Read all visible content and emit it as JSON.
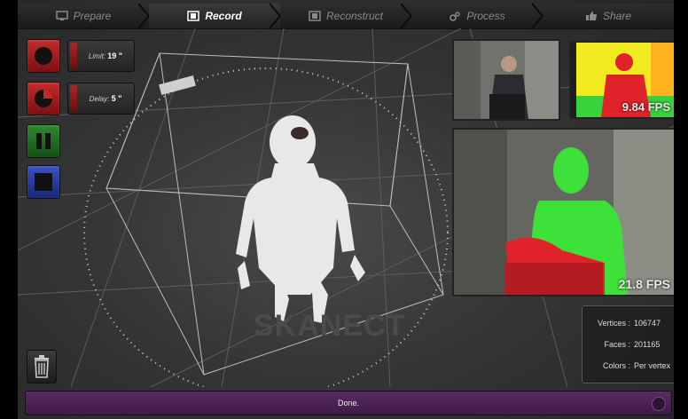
{
  "tabs": [
    {
      "label": "Prepare",
      "icon": "monitor-icon",
      "active": false
    },
    {
      "label": "Record",
      "icon": "film-icon",
      "active": true
    },
    {
      "label": "Reconstruct",
      "icon": "film-icon",
      "active": false
    },
    {
      "label": "Process",
      "icon": "gears-icon",
      "active": false
    },
    {
      "label": "Share",
      "icon": "thumbs-up-icon",
      "active": false
    }
  ],
  "controls": {
    "limit_label": "Limit:",
    "limit_value": "19 \"",
    "delay_label": "Delay:",
    "delay_value": "5 \""
  },
  "cameras": {
    "depth_fps": "9.84 FPS",
    "overlay_fps": "21.8 FPS"
  },
  "stats": {
    "vertices_label": "Vertices :",
    "vertices_value": "106747",
    "faces_label": "Faces :",
    "faces_value": "201165",
    "colors_label": "Colors :",
    "colors_value": "Per vertex"
  },
  "status": {
    "message": "Done."
  },
  "watermark": "SKANECT",
  "colors": {
    "record": "#c62b2b",
    "pause": "#2e8a2e",
    "stop": "#3a52c0",
    "status_bar": "#4e2456",
    "depth_bg": "#f3ef1c",
    "mask_green": "#3ee03a",
    "mask_red": "#e0232a"
  }
}
